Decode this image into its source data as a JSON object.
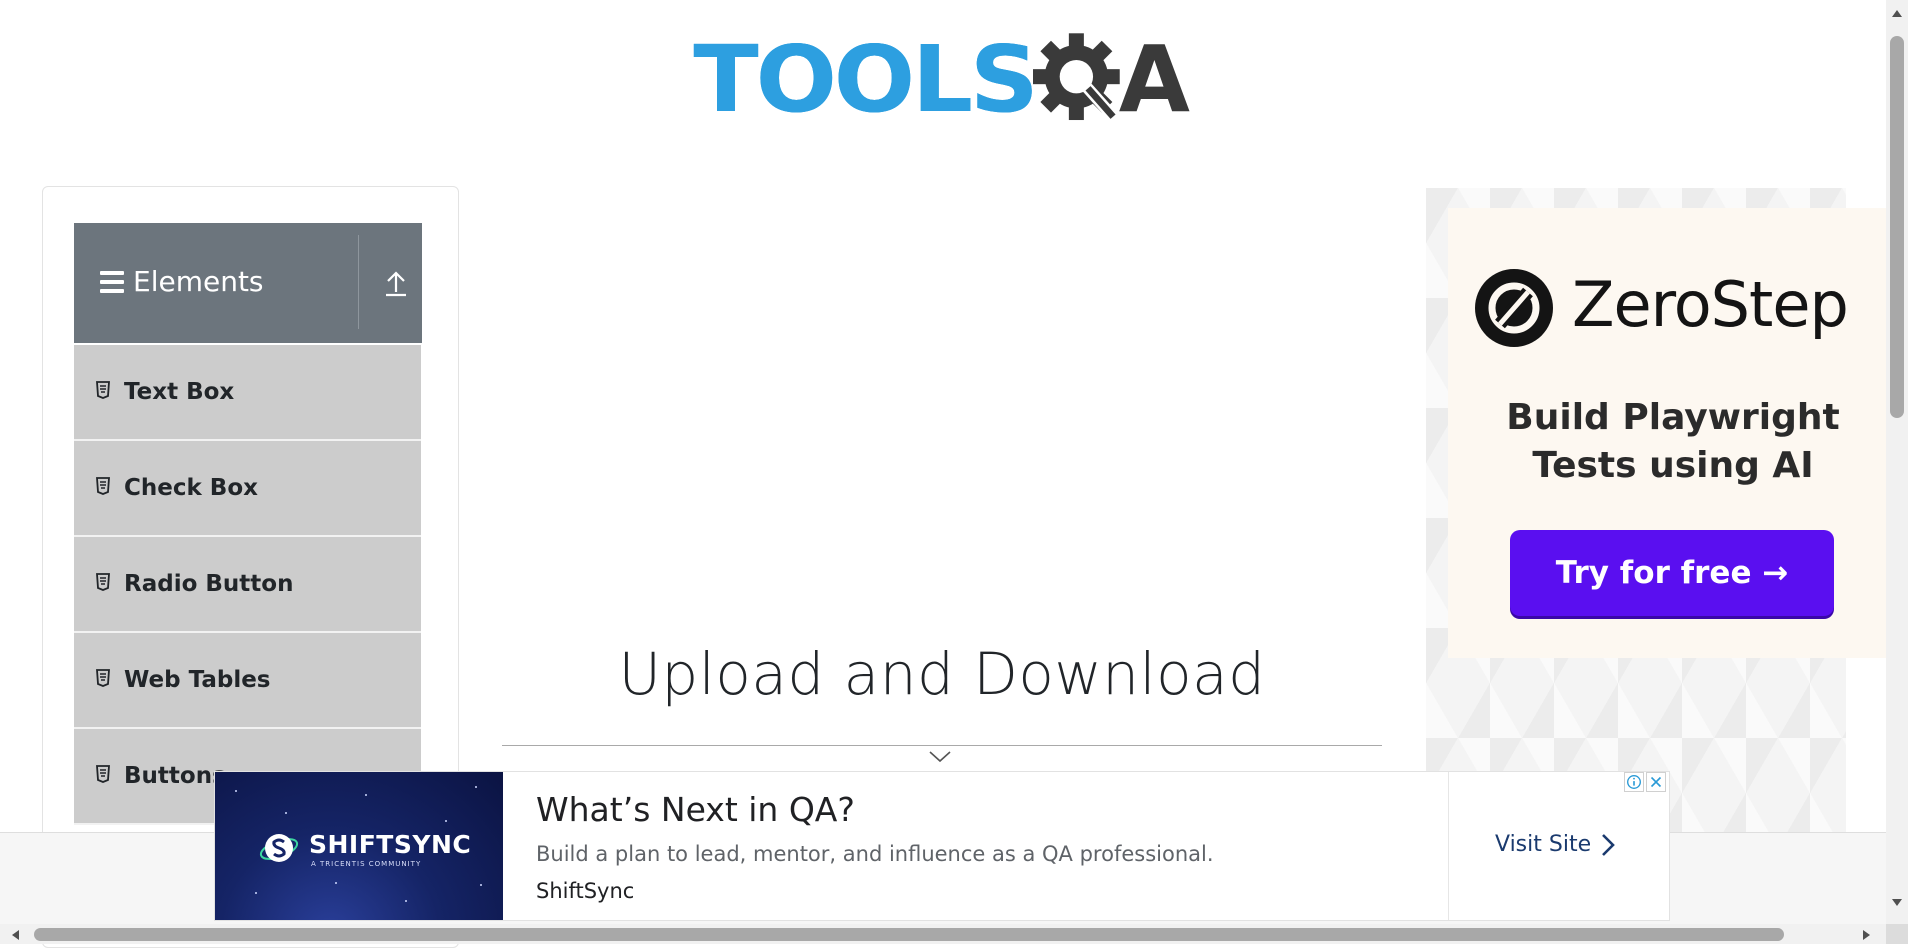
{
  "header": {
    "logo_part1": "TOOLS",
    "logo_part2": "A",
    "logo_icon": "gear-magnifier-icon"
  },
  "sidebar": {
    "group_title": "Elements",
    "group_icon": "hamburger-icon",
    "toggle_icon": "upload-arrow-icon",
    "items": [
      {
        "label": "Text Box",
        "icon": "html5-icon"
      },
      {
        "label": "Check Box",
        "icon": "html5-icon"
      },
      {
        "label": "Radio Button",
        "icon": "html5-icon"
      },
      {
        "label": "Web Tables",
        "icon": "html5-icon"
      },
      {
        "label": "Buttons",
        "icon": "html5-icon"
      }
    ]
  },
  "main": {
    "title": "Upload and Download"
  },
  "ad_right": {
    "brand": "ZeroStep",
    "tagline": "Build Playwright Tests using AI",
    "cta": "Try for free →",
    "cta_color": "#5a0ff0"
  },
  "ad_bottom": {
    "image_brand": "SHIFTSYNC",
    "image_subtitle": "A TRICENTIS COMMUNITY",
    "title": "What’s Next in QA?",
    "description": "Build a plan to lead, mentor, and influence as a QA professional.",
    "advertiser": "ShiftSync",
    "cta": "Visit Site"
  },
  "colors": {
    "logo_blue": "#2d9fe0",
    "logo_dark": "#3a3a3a",
    "group_header": "#6c757d",
    "menu_item_bg": "#cccccc"
  }
}
